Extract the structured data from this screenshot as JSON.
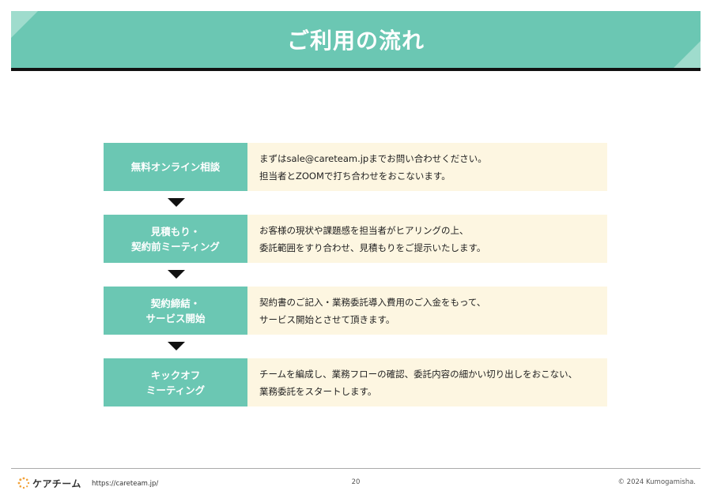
{
  "header": {
    "title": "ご利用の流れ"
  },
  "steps": [
    {
      "label_lines": [
        "無料オンライン相談"
      ],
      "desc_lines": [
        "まずはsale@careteam.jpまでお問い合わせください。",
        "担当者とZOOMで打ち合わせをおこないます。"
      ]
    },
    {
      "label_lines": [
        "見積もり・",
        "契約前ミーティング"
      ],
      "desc_lines": [
        "お客様の現状や課題感を担当者がヒアリングの上、",
        "委託範囲をすり合わせ、見積もりをご提示いたします。"
      ]
    },
    {
      "label_lines": [
        "契約締結・",
        "サービス開始"
      ],
      "desc_lines": [
        "契約書のご記入・業務委託導入費用のご入金をもって、",
        "サービス開始とさせて頂きます。"
      ]
    },
    {
      "label_lines": [
        "キックオフ",
        "ミーティング"
      ],
      "desc_lines": [
        "チームを編成し、業務フローの確認、委託内容の細かい切り出しをおこない、",
        "業務委託をスタートします。"
      ]
    }
  ],
  "footer": {
    "logo_text": "ケアチーム",
    "url": "https://careteam.jp/",
    "page_number": "20",
    "copyright": "© 2024 Kumogamisha."
  },
  "colors": {
    "accent": "#6bc7b3",
    "accent_light": "#9fdccd",
    "desc_bg": "#fdf6e1",
    "logo_orange": "#f2a23a"
  }
}
